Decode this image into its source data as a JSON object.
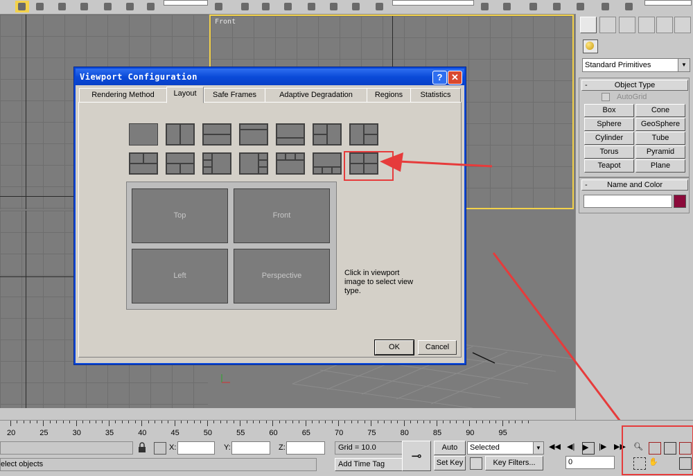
{
  "viewports": {
    "front_label": "Front"
  },
  "command_panel": {
    "dropdown_value": "Standard Primitives",
    "object_type": {
      "title": "Object Type",
      "autogrid_label": "AutoGrid",
      "buttons": [
        "Box",
        "Cone",
        "Sphere",
        "GeoSphere",
        "Cylinder",
        "Tube",
        "Torus",
        "Pyramid",
        "Teapot",
        "Plane"
      ]
    },
    "name_color": {
      "title": "Name and Color",
      "color": "#8b0a3a"
    }
  },
  "dialog": {
    "title": "Viewport Configuration",
    "help_glyph": "?",
    "close_glyph": "✕",
    "tabs": [
      "Rendering Method",
      "Layout",
      "Safe Frames",
      "Adaptive Degradation",
      "Regions",
      "Statistics"
    ],
    "active_tab": "Layout",
    "preview": {
      "top": "Top",
      "front": "Front",
      "left": "Left",
      "perspective": "Perspective"
    },
    "hint": "Click in viewport image to select view type.",
    "ok": "OK",
    "cancel": "Cancel"
  },
  "timeline": {
    "ticks": [
      "20",
      "25",
      "30",
      "35",
      "40",
      "45",
      "50",
      "55",
      "60",
      "65",
      "70",
      "75",
      "80",
      "85",
      "90",
      "95"
    ]
  },
  "status": {
    "x_label": "X:",
    "y_label": "Y:",
    "z_label": "Z:",
    "grid": "Grid = 10.0",
    "add_time_tag": "Add Time Tag",
    "auto_key": "Auto Key",
    "set_key": "Set Key",
    "selected": "Selected",
    "key_filters": "Key Filters...",
    "frame": "0",
    "prompt": "elect objects"
  },
  "colors": {
    "annotation": "#e63b3b",
    "dialog_title": "#0a4ad8"
  }
}
